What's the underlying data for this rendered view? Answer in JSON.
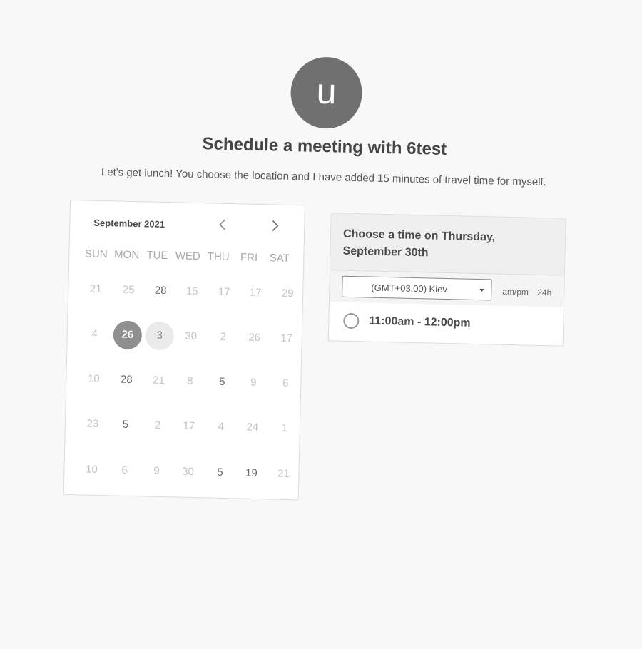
{
  "avatar": {
    "letter": "u"
  },
  "header": {
    "title": "Schedule a meeting with 6test",
    "subtitle": "Let's get lunch! You choose the location and I have added 15 minutes of travel time for myself."
  },
  "calendar": {
    "month_label": "September 2021",
    "prev_icon": "chevron-left-icon",
    "next_icon": "chevron-right-icon",
    "weekdays": [
      "SUN",
      "MON",
      "TUE",
      "WED",
      "THU",
      "FRI",
      "SAT"
    ],
    "weeks": [
      [
        {
          "label": "21",
          "state": "unavailable"
        },
        {
          "label": "25",
          "state": "unavailable"
        },
        {
          "label": "28",
          "state": "available"
        },
        {
          "label": "15",
          "state": "unavailable"
        },
        {
          "label": "17",
          "state": "unavailable"
        },
        {
          "label": "17",
          "state": "unavailable"
        },
        {
          "label": "29",
          "state": "unavailable"
        }
      ],
      [
        {
          "label": "4",
          "state": "unavailable"
        },
        {
          "label": "26",
          "state": "selected"
        },
        {
          "label": "3",
          "state": "today"
        },
        {
          "label": "30",
          "state": "unavailable"
        },
        {
          "label": "2",
          "state": "unavailable"
        },
        {
          "label": "26",
          "state": "unavailable"
        },
        {
          "label": "17",
          "state": "unavailable"
        }
      ],
      [
        {
          "label": "10",
          "state": "unavailable"
        },
        {
          "label": "28",
          "state": "available"
        },
        {
          "label": "21",
          "state": "unavailable"
        },
        {
          "label": "8",
          "state": "unavailable"
        },
        {
          "label": "5",
          "state": "available"
        },
        {
          "label": "9",
          "state": "unavailable"
        },
        {
          "label": "6",
          "state": "unavailable"
        }
      ],
      [
        {
          "label": "23",
          "state": "unavailable"
        },
        {
          "label": "5",
          "state": "available"
        },
        {
          "label": "2",
          "state": "unavailable"
        },
        {
          "label": "17",
          "state": "unavailable"
        },
        {
          "label": "4",
          "state": "unavailable"
        },
        {
          "label": "24",
          "state": "unavailable"
        },
        {
          "label": "1",
          "state": "unavailable"
        }
      ],
      [
        {
          "label": "10",
          "state": "unavailable"
        },
        {
          "label": "6",
          "state": "unavailable"
        },
        {
          "label": "9",
          "state": "unavailable"
        },
        {
          "label": "30",
          "state": "unavailable"
        },
        {
          "label": "5",
          "state": "available"
        },
        {
          "label": "19",
          "state": "available"
        },
        {
          "label": "21",
          "state": "unavailable"
        }
      ]
    ]
  },
  "time_panel": {
    "heading": "Choose a time on Thursday, September 30th",
    "timezone": "(GMT+03:00) Kiev",
    "timezone_icon": "caret-down-icon",
    "format_ampm": "am/pm",
    "format_24h": "24h",
    "slots": [
      {
        "label": "11:00am - 12:00pm",
        "selected": false
      }
    ]
  },
  "colors": {
    "background": "#f8f8f8",
    "selected_day": "#8f8f8f",
    "today_day": "#eaeaea",
    "avatar": "#707070"
  }
}
